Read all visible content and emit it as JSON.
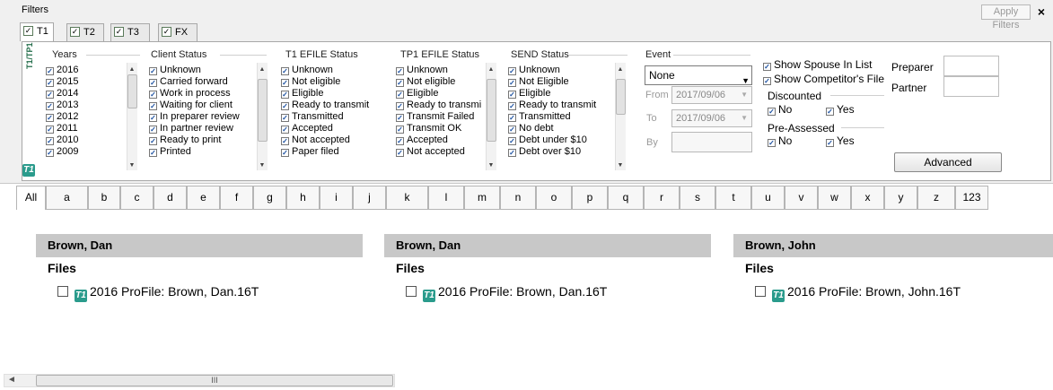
{
  "header": {
    "title": "Filters",
    "apply_filters": "Apply Filters",
    "close": "×"
  },
  "tabs": [
    {
      "label": "T1",
      "checked": "☑"
    },
    {
      "label": "T2",
      "checked": "☑"
    },
    {
      "label": "T3",
      "checked": "☑"
    },
    {
      "label": "FX",
      "checked": "☑"
    }
  ],
  "side_tab": "T1/TP1",
  "logo_text": "T1",
  "check_mark": "✓",
  "years": {
    "label": "Years",
    "items": [
      "2016",
      "2015",
      "2014",
      "2013",
      "2012",
      "2011",
      "2010",
      "2009"
    ]
  },
  "client_status": {
    "label": "Client Status",
    "items": [
      "Unknown",
      "Carried forward",
      "Work in process",
      "Waiting for client",
      "In preparer review",
      "In partner review",
      "Ready to print",
      "Printed"
    ]
  },
  "t1_efile": {
    "label": "T1 EFILE Status",
    "items": [
      "Unknown",
      "Not eligible",
      "Eligible",
      "Ready to transmit",
      "Transmitted",
      "Accepted",
      "Not accepted",
      "Paper filed"
    ]
  },
  "tp1_efile": {
    "label": "TP1 EFILE Status",
    "items": [
      "Unknown",
      "Not eligible",
      "Eligible",
      "Ready to transmi",
      "Transmit Failed",
      "Transmit OK",
      "Accepted",
      "Not accepted"
    ]
  },
  "send_status": {
    "label": "SEND Status",
    "items": [
      "Unknown",
      "Not Eligible",
      "Eligible",
      "Ready to transmit",
      "Transmitted",
      "No debt",
      "Debt under $10",
      "Debt over $10"
    ]
  },
  "event": {
    "label": "Event",
    "value": "None",
    "from_label": "From",
    "from_value": "2017/09/06",
    "to_label": "To",
    "to_value": "2017/09/06",
    "by_label": "By"
  },
  "options": {
    "show_spouse": "Show Spouse In List",
    "show_competitor": "Show Competitor's File",
    "discounted": {
      "label": "Discounted",
      "no": "No",
      "yes": "Yes"
    },
    "pre_assessed": {
      "label": "Pre-Assessed",
      "no": "No",
      "yes": "Yes"
    },
    "preparer": "Preparer",
    "partner": "Partner",
    "advanced": "Advanced"
  },
  "alphabet": [
    "All",
    "a",
    "b",
    "c",
    "d",
    "e",
    "f",
    "g",
    "h",
    "i",
    "j",
    "k",
    "l",
    "m",
    "n",
    "o",
    "p",
    "q",
    "r",
    "s",
    "t",
    "u",
    "v",
    "w",
    "x",
    "y",
    "z",
    "123"
  ],
  "clients": [
    {
      "name": "Brown, Dan",
      "files_label": "Files",
      "file": "2016 ProFile: Brown, Dan.16T"
    },
    {
      "name": "Brown, Dan",
      "files_label": "Files",
      "file": "2016 ProFile: Brown, Dan.16T"
    },
    {
      "name": "Brown, John",
      "files_label": "Files",
      "file": "2016 ProFile: Brown, John.16T"
    }
  ],
  "scrollbar": {
    "grip": "III",
    "left_arrow": "◄"
  }
}
